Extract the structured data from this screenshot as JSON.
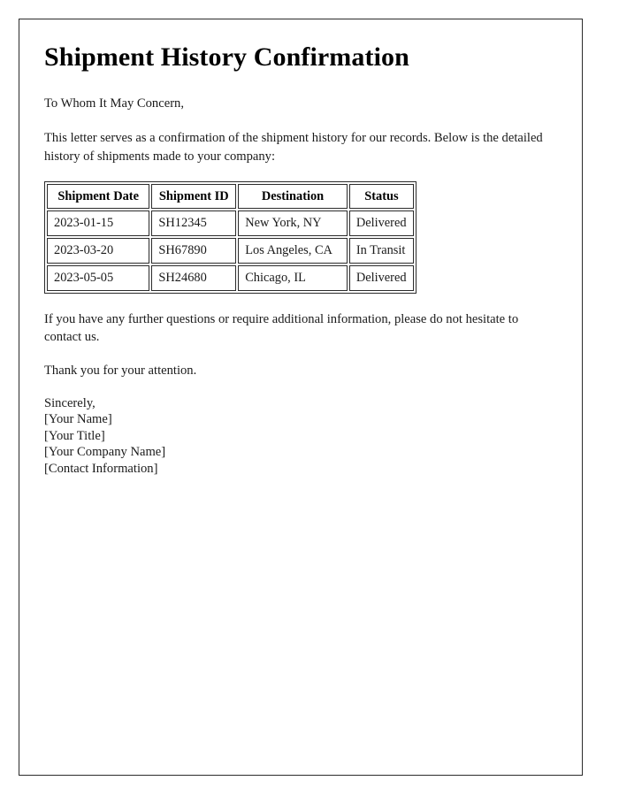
{
  "document": {
    "title": "Shipment History Confirmation",
    "salutation": "To Whom It May Concern,",
    "intro_paragraph": "This letter serves as a confirmation of the shipment history for our records. Below is the detailed history of shipments made to your company:",
    "closing_paragraph": "If you have any further questions or require additional information, please do not hesitate to contact us.",
    "thanks_paragraph": "Thank you for your attention."
  },
  "table": {
    "columns": [
      "Shipment Date",
      "Shipment ID",
      "Destination",
      "Status"
    ],
    "rows": [
      {
        "shipment_date": "2023-01-15",
        "shipment_id": "SH12345",
        "destination": "New York, NY",
        "status": "Delivered"
      },
      {
        "shipment_date": "2023-03-20",
        "shipment_id": "SH67890",
        "destination": "Los Angeles, CA",
        "status": "In Transit"
      },
      {
        "shipment_date": "2023-05-05",
        "shipment_id": "SH24680",
        "destination": "Chicago, IL",
        "status": "Delivered"
      }
    ]
  },
  "signature": {
    "lines": [
      "Sincerely,",
      "[Your Name]",
      "[Your Title]",
      "[Your Company Name]",
      "[Contact Information]"
    ]
  },
  "colors": {
    "page_background": "#ffffff",
    "border": "#2b2b2b",
    "text": "#1a1a1a",
    "heading": "#000000"
  }
}
